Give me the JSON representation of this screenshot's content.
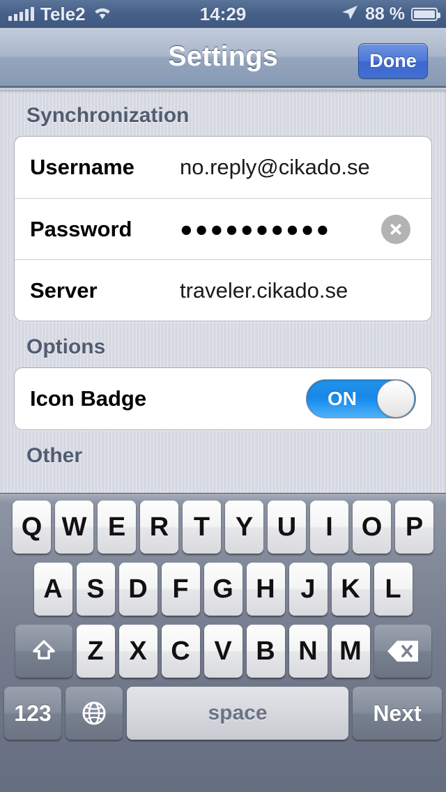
{
  "statusbar": {
    "signal_icon": "signal-bars-icon",
    "carrier": "Tele2",
    "wifi_icon": "wifi-icon",
    "time": "14:29",
    "location_icon": "location-arrow-icon",
    "battery_percent": "88 %",
    "battery_icon": "battery-icon"
  },
  "navbar": {
    "title": "Settings",
    "done_label": "Done"
  },
  "sections": [
    {
      "header": "Synchronization",
      "rows": [
        {
          "label": "Username",
          "value": "no.reply@cikado.se"
        },
        {
          "label": "Password",
          "value": "●●●●●●●●●●",
          "clear_icon": "clear-circle-x-icon"
        },
        {
          "label": "Server",
          "value": "traveler.cikado.se"
        }
      ]
    },
    {
      "header": "Options",
      "rows": [
        {
          "label": "Icon Badge",
          "toggle_state": "ON"
        }
      ]
    },
    {
      "header": "Other",
      "rows": []
    }
  ],
  "keyboard": {
    "row1": [
      "Q",
      "W",
      "E",
      "R",
      "T",
      "Y",
      "U",
      "I",
      "O",
      "P"
    ],
    "row2": [
      "A",
      "S",
      "D",
      "F",
      "G",
      "H",
      "J",
      "K",
      "L"
    ],
    "row3": [
      "Z",
      "X",
      "C",
      "V",
      "B",
      "N",
      "M"
    ],
    "shift_icon": "shift-arrow-icon",
    "delete_icon": "backspace-delete-icon",
    "numbers_label": "123",
    "globe_icon": "globe-keyboard-icon",
    "space_label": "space",
    "next_label": "Next"
  },
  "colors": {
    "accent_blue": "#3c68cf",
    "toggle_on": "#1d8ff0",
    "nav_title": "#ffffff",
    "section_header": "#515c70"
  }
}
